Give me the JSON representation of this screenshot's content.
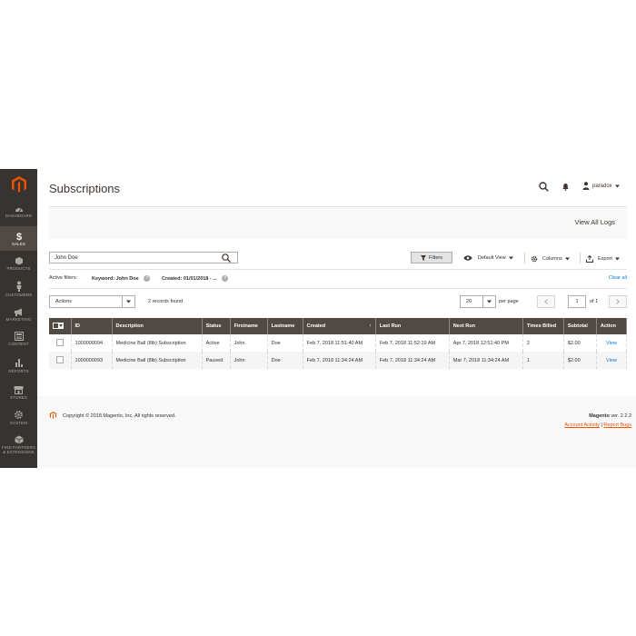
{
  "sidebar": {
    "items": [
      {
        "label": "DASHBOARD",
        "icon": "dashboard-icon"
      },
      {
        "label": "SALES",
        "icon": "dollar-icon"
      },
      {
        "label": "PRODUCTS",
        "icon": "box-icon"
      },
      {
        "label": "CUSTOMERS",
        "icon": "person-icon"
      },
      {
        "label": "MARKETING",
        "icon": "megaphone-icon"
      },
      {
        "label": "CONTENT",
        "icon": "layout-icon"
      },
      {
        "label": "REPORTS",
        "icon": "bar-chart-icon"
      },
      {
        "label": "STORES",
        "icon": "store-icon"
      },
      {
        "label": "SYSTEM",
        "icon": "gear-icon"
      },
      {
        "label": "FIND PARTNERS",
        "label2": "& EXTENSIONS",
        "icon": "cube-icon"
      }
    ]
  },
  "header": {
    "title": "Subscriptions",
    "user": "paradox"
  },
  "actionbar": {
    "view_logs": "View All Logs"
  },
  "toolbar": {
    "search_value": "John Doe",
    "filters": "Filters",
    "default_view": "Default View",
    "columns": "Columns",
    "export": "Export"
  },
  "active_filters": {
    "label": "Active filters:",
    "chips": [
      {
        "name": "Keyword:",
        "value": "John Doe"
      },
      {
        "name": "Created:",
        "value": "01/01/2018 - ..."
      }
    ],
    "clear_all": "Clear all"
  },
  "grid_controls": {
    "actions": "Actions",
    "records": "2 records found",
    "per_page_value": "20",
    "per_page_label": "per page",
    "page": "1",
    "of": "of 1"
  },
  "table": {
    "columns": [
      "ID",
      "Description",
      "Status",
      "Firstname",
      "Lastname",
      "Created",
      "Last Run",
      "Next Run",
      "Times Billed",
      "Subtotal",
      "Action"
    ],
    "sort_indicator": "↑",
    "rows": [
      [
        "1000000094",
        "Medicine Ball (8lb) Subscription",
        "Active",
        "John",
        "Doe",
        "Feb 7, 2018 11:51:40 AM",
        "Feb 7, 2018 11:52:19 AM",
        "Apr 7, 2018 12:51:40 PM",
        "2",
        "$2.00",
        "View"
      ],
      [
        "1000000093",
        "Medicine Ball (8lb) Subscription",
        "Paused",
        "John",
        "Doe",
        "Feb 7, 2018 11:34:24 AM",
        "Feb 7, 2018 11:34:24 AM",
        "Mar 7, 2018 11:34:24 AM",
        "1",
        "$2.00",
        "View"
      ]
    ]
  },
  "footer": {
    "copyright": "Copyright © 2018 Magento, Inc. All rights reserved.",
    "brand": "Magento",
    "version": " ver. 2.2.2",
    "account_activity": "Account Activity",
    "divider": " | ",
    "report_bugs": "Report Bugs"
  },
  "colors": {
    "sidebar_bg": "#373330",
    "accent": "#eb5202",
    "header_bg": "#514943",
    "link": "#007bdb"
  }
}
